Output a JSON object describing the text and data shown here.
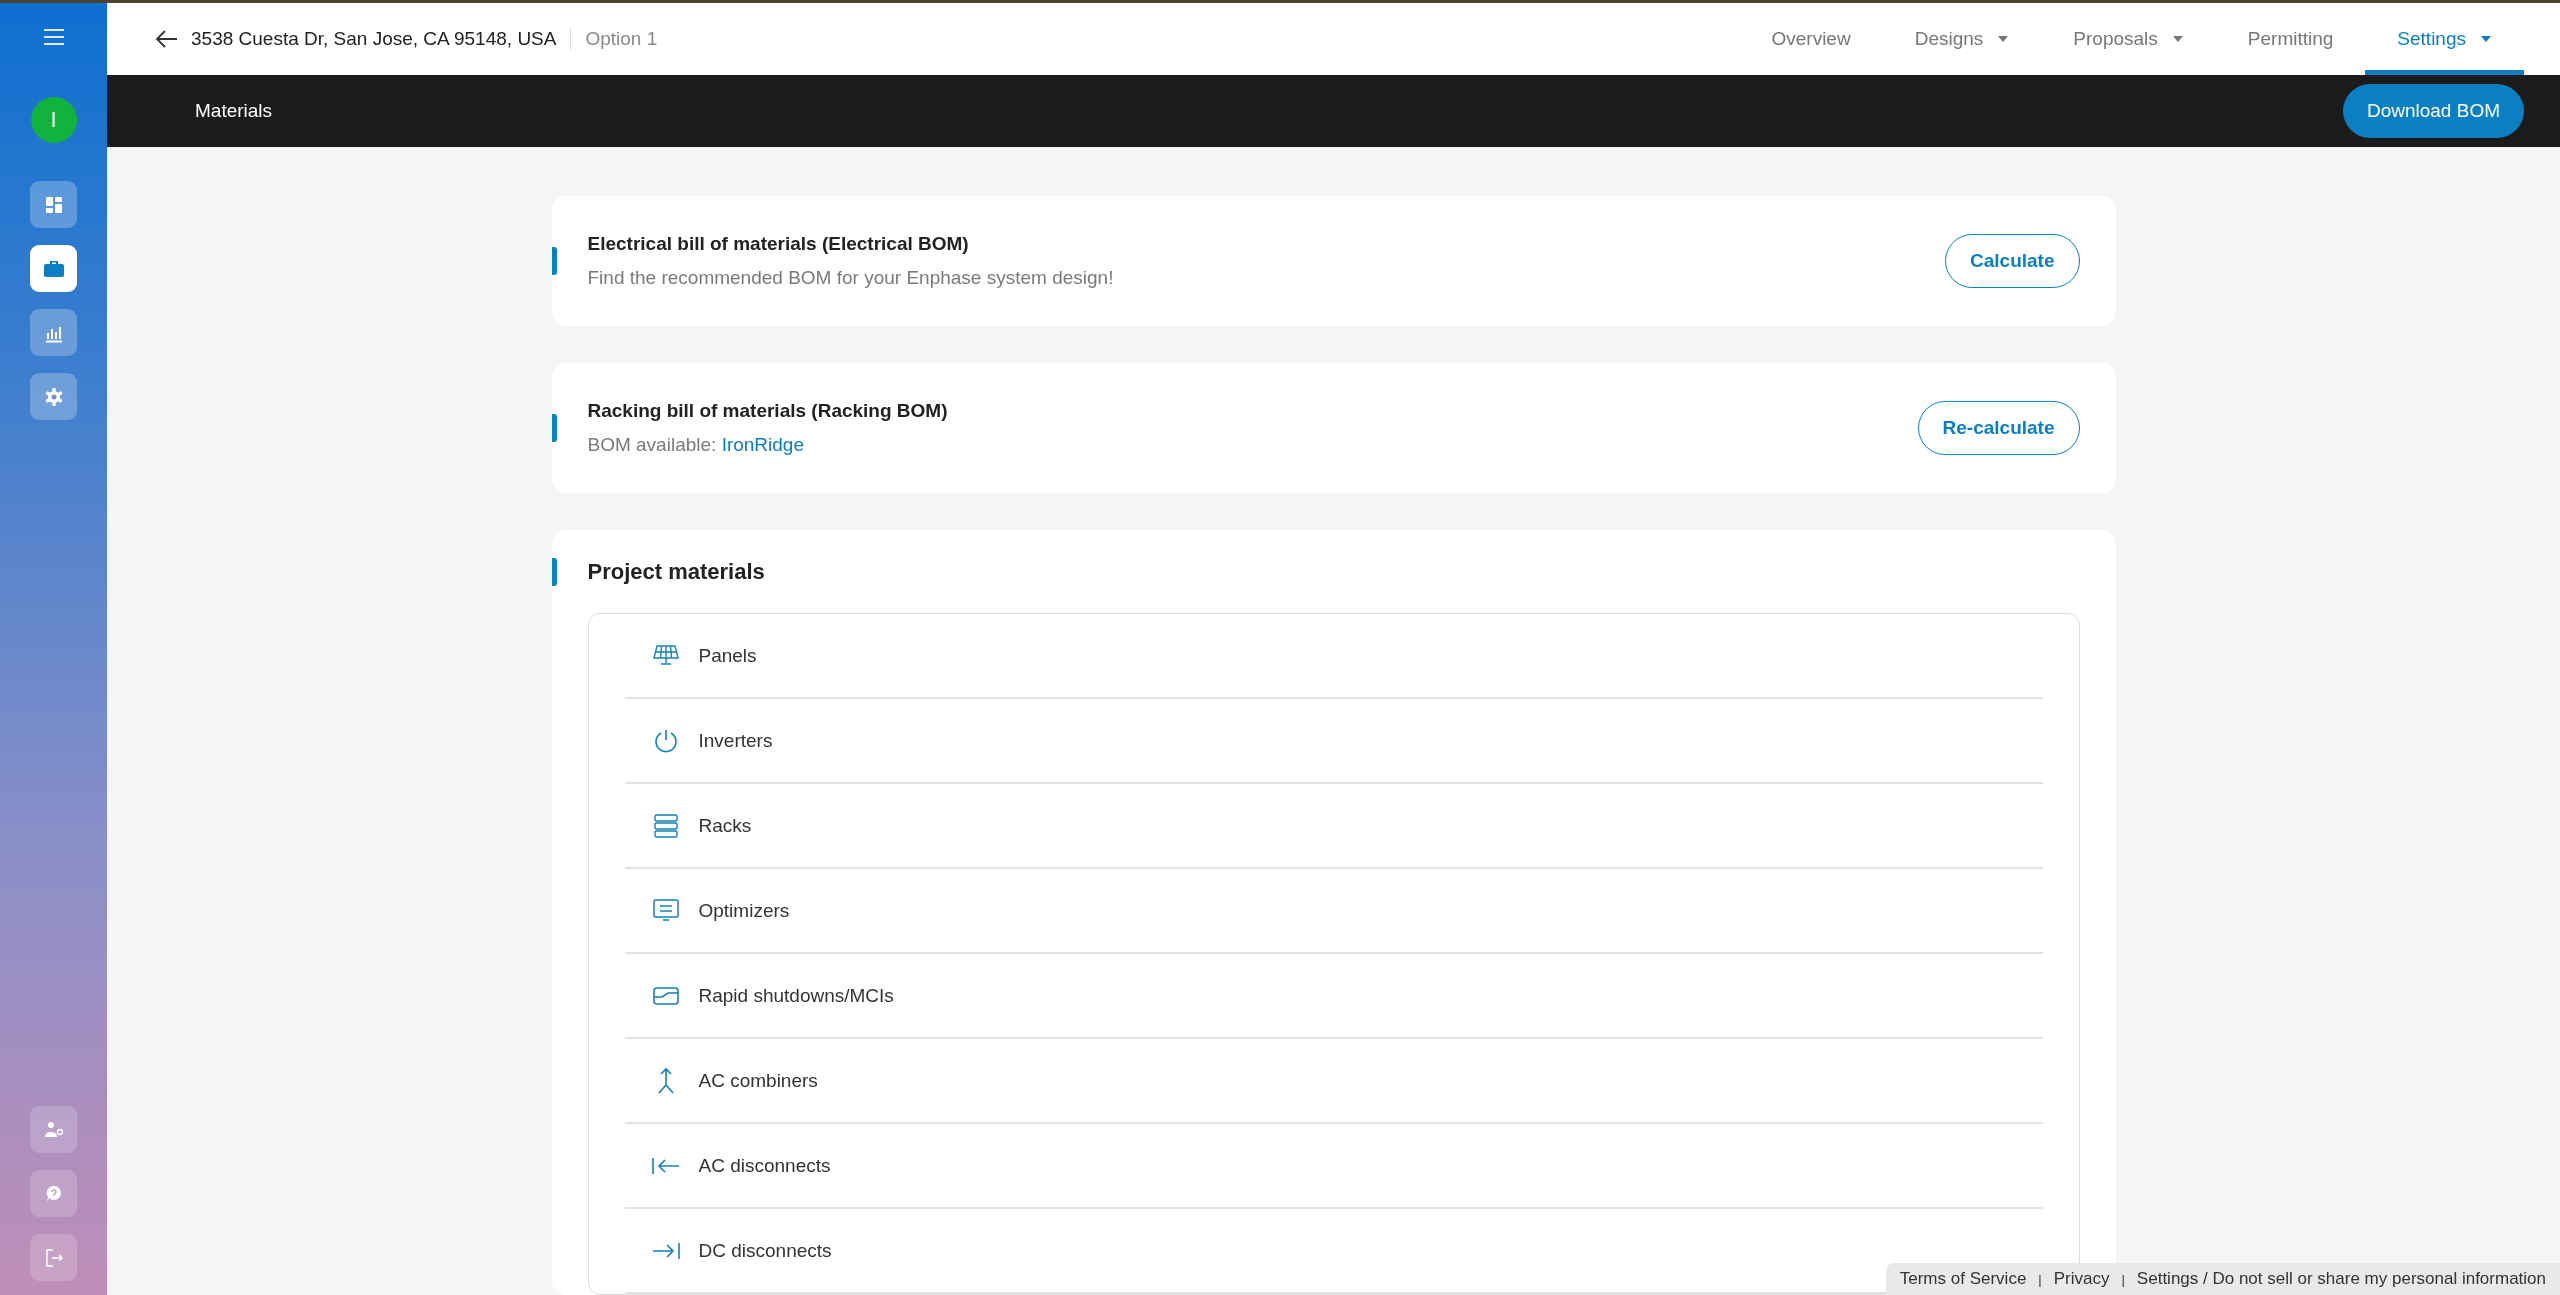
{
  "sidebar": {
    "avatar": "I",
    "items": [
      {
        "kind": "dashboard",
        "selected": false
      },
      {
        "kind": "projects",
        "selected": true
      },
      {
        "kind": "reports",
        "selected": false
      },
      {
        "kind": "settings",
        "selected": false
      }
    ],
    "bottom_items": [
      {
        "kind": "team"
      },
      {
        "kind": "help"
      },
      {
        "kind": "logout"
      }
    ]
  },
  "header": {
    "address": "3538 Cuesta Dr, San Jose, CA 95148, USA",
    "option": "Option 1",
    "tabs": [
      {
        "label": "Overview",
        "dropdown": false,
        "selected": false
      },
      {
        "label": "Designs",
        "dropdown": true,
        "selected": false
      },
      {
        "label": "Proposals",
        "dropdown": true,
        "selected": false
      },
      {
        "label": "Permitting",
        "dropdown": false,
        "selected": false
      },
      {
        "label": "Settings",
        "dropdown": true,
        "selected": true
      }
    ]
  },
  "toolbar": {
    "title": "Materials",
    "button": "Download BOM"
  },
  "bom_cards": [
    {
      "title": "Electrical bill of materials (Electrical BOM)",
      "text": "Find the recommended BOM for your Enphase system design!",
      "button": "Calculate"
    },
    {
      "title": "Racking bill of materials (Racking BOM)",
      "text": "BOM available:",
      "link": "IronRidge",
      "button": "Re-calculate"
    }
  ],
  "project_materials": {
    "title": "Project materials",
    "items": [
      {
        "kind": "panels",
        "label": "Panels"
      },
      {
        "kind": "inverters",
        "label": "Inverters"
      },
      {
        "kind": "racks",
        "label": "Racks"
      },
      {
        "kind": "optimizers",
        "label": "Optimizers"
      },
      {
        "kind": "rapid",
        "label": "Rapid shutdowns/MCIs"
      },
      {
        "kind": "combiners",
        "label": "AC combiners"
      },
      {
        "kind": "ac_disconnect",
        "label": "AC disconnects"
      },
      {
        "kind": "dc_disconnect",
        "label": "DC disconnects"
      }
    ]
  },
  "footer": [
    {
      "kind": "link",
      "text": "Terms of Service"
    },
    {
      "kind": "separator",
      "text": "|"
    },
    {
      "kind": "link",
      "text": "Privacy"
    },
    {
      "kind": "separator",
      "text": "|"
    },
    {
      "kind": "link",
      "text": "Settings / Do not sell or share my personal information"
    }
  ]
}
